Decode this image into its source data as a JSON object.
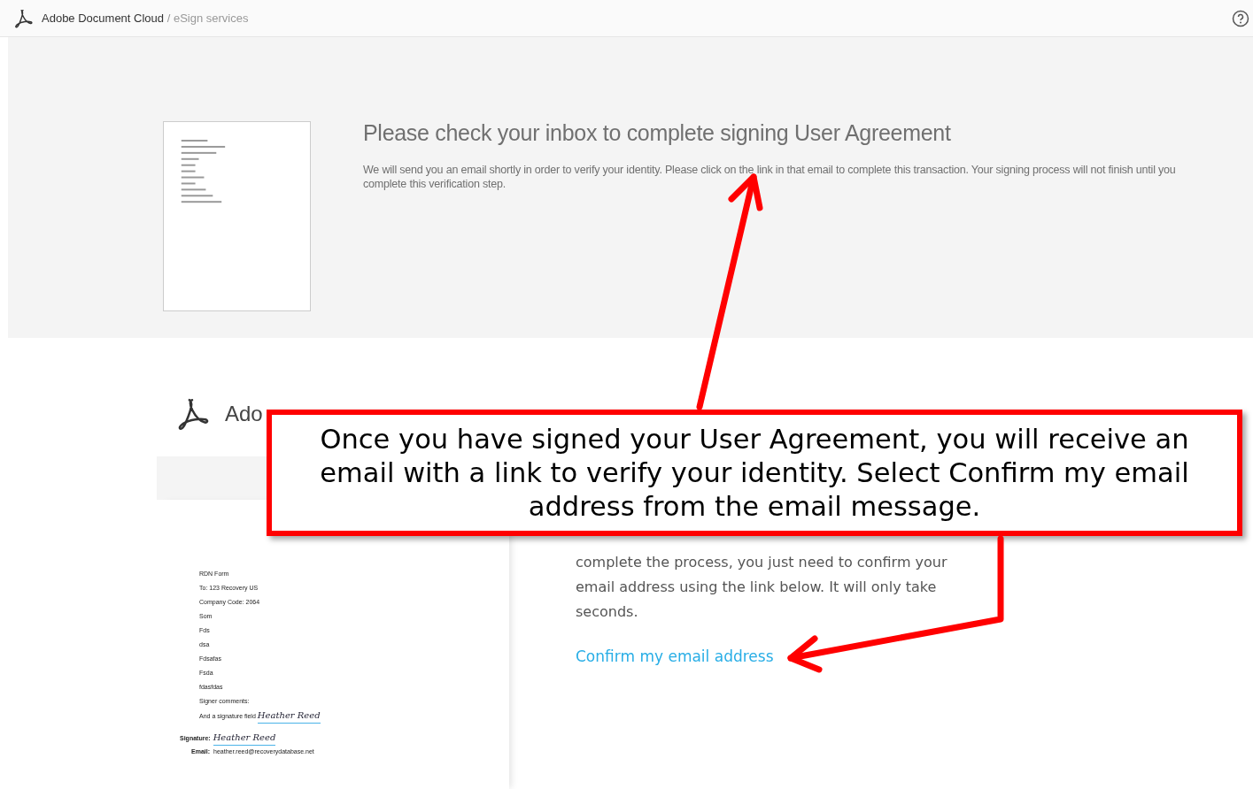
{
  "header": {
    "brand": "Adobe Document Cloud",
    "separator": "/",
    "service": "eSign services"
  },
  "signing_panel": {
    "title": "Please check your inbox to complete signing User Agreement",
    "message": "We will send you an email shortly in order to verify your identity. Please click on the link in that email to complete this transaction. Your signing process will not finish until you complete this verification step."
  },
  "email": {
    "brand": "Ado",
    "document_lines": [
      "RDN Form",
      "To:  123 Recovery US",
      "Company Code:  2064",
      "Som",
      "Fds",
      "dsa",
      "Fdsafas",
      "Fsda",
      "fdasfdas",
      "Signer comments:"
    ],
    "signature_field_label": "And a signature field",
    "field_signature": "Heather Reed",
    "signature_label": "Signature:",
    "signature": "Heather Reed",
    "email_label": "Email:",
    "email_value": "heather.reed@recoverydatabase.net",
    "body": "complete the process, you just need to confirm your email address using the link below. It will only take seconds.",
    "link": "Confirm my email address"
  },
  "callout": {
    "text": "Once you have signed your User Agreement, you will receive an email with a link to verify your identity. Select Confirm my email address from the email message."
  }
}
